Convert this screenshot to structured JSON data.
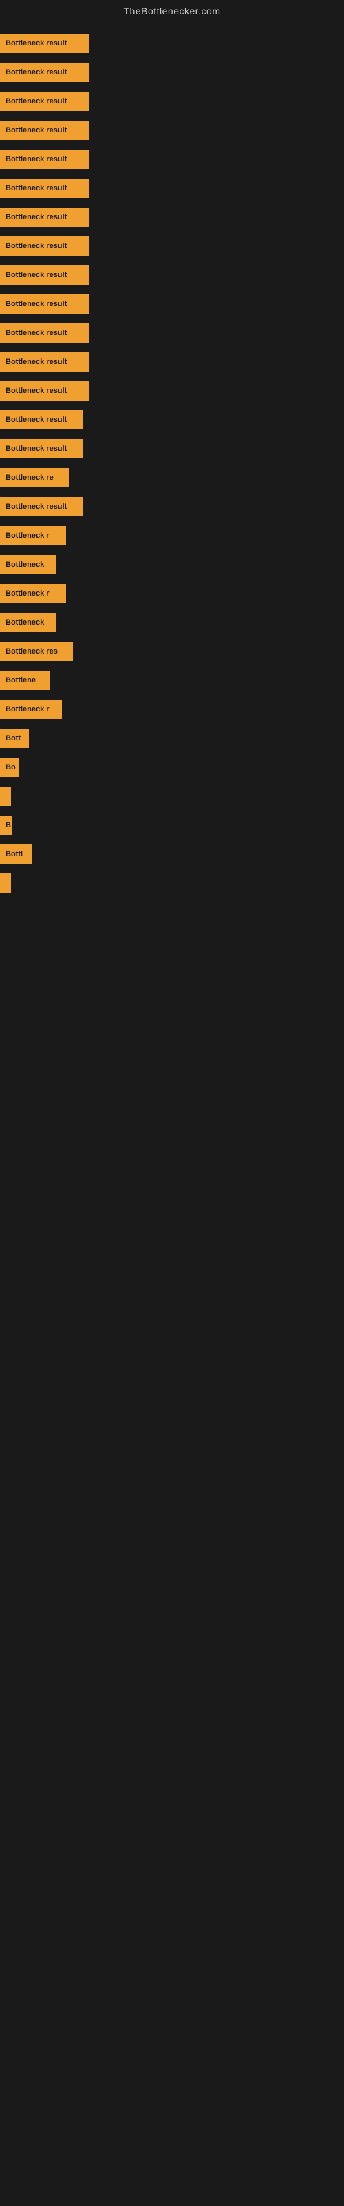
{
  "site": {
    "title": "TheBottlenecker.com"
  },
  "bars": [
    {
      "label": "Bottleneck result",
      "width": 130
    },
    {
      "label": "Bottleneck result",
      "width": 130
    },
    {
      "label": "Bottleneck result",
      "width": 130
    },
    {
      "label": "Bottleneck result",
      "width": 130
    },
    {
      "label": "Bottleneck result",
      "width": 130
    },
    {
      "label": "Bottleneck result",
      "width": 130
    },
    {
      "label": "Bottleneck result",
      "width": 130
    },
    {
      "label": "Bottleneck result",
      "width": 130
    },
    {
      "label": "Bottleneck result",
      "width": 130
    },
    {
      "label": "Bottleneck result",
      "width": 130
    },
    {
      "label": "Bottleneck result",
      "width": 130
    },
    {
      "label": "Bottleneck result",
      "width": 130
    },
    {
      "label": "Bottleneck result",
      "width": 130
    },
    {
      "label": "Bottleneck result",
      "width": 120
    },
    {
      "label": "Bottleneck result",
      "width": 120
    },
    {
      "label": "Bottleneck re",
      "width": 100
    },
    {
      "label": "Bottleneck result",
      "width": 120
    },
    {
      "label": "Bottleneck r",
      "width": 96
    },
    {
      "label": "Bottleneck",
      "width": 82
    },
    {
      "label": "Bottleneck r",
      "width": 96
    },
    {
      "label": "Bottleneck",
      "width": 82
    },
    {
      "label": "Bottleneck res",
      "width": 106
    },
    {
      "label": "Bottlene",
      "width": 72
    },
    {
      "label": "Bottleneck r",
      "width": 90
    },
    {
      "label": "Bott",
      "width": 42
    },
    {
      "label": "Bo",
      "width": 28
    },
    {
      "label": "",
      "width": 6
    },
    {
      "label": "B",
      "width": 18
    },
    {
      "label": "Bottl",
      "width": 46
    },
    {
      "label": "",
      "width": 4
    },
    {
      "label": "",
      "width": 0
    },
    {
      "label": "",
      "width": 0
    },
    {
      "label": "",
      "width": 0
    },
    {
      "label": "",
      "width": 0
    },
    {
      "label": "",
      "width": 0
    },
    {
      "label": "",
      "width": 0
    },
    {
      "label": "",
      "width": 0
    },
    {
      "label": "",
      "width": 0
    }
  ]
}
